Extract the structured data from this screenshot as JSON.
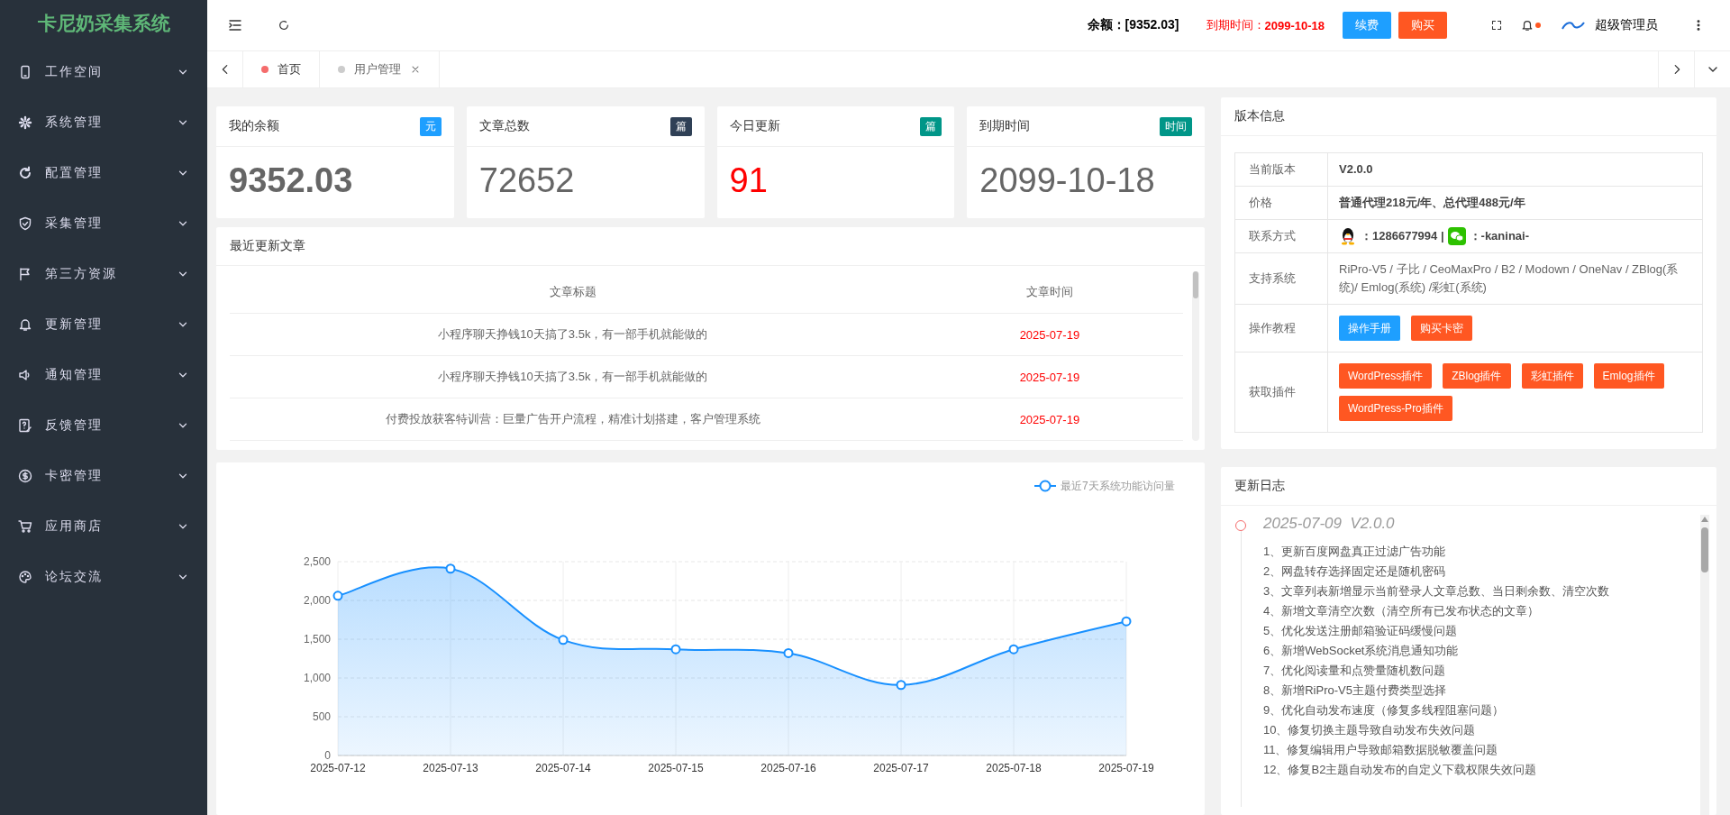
{
  "sidebar": {
    "logo": "卡尼奶采集系统",
    "items": [
      {
        "label": "工作空间"
      },
      {
        "label": "系统管理"
      },
      {
        "label": "配置管理"
      },
      {
        "label": "采集管理"
      },
      {
        "label": "第三方资源"
      },
      {
        "label": "更新管理"
      },
      {
        "label": "通知管理"
      },
      {
        "label": "反馈管理"
      },
      {
        "label": "卡密管理"
      },
      {
        "label": "应用商店"
      },
      {
        "label": "论坛交流"
      }
    ]
  },
  "header": {
    "balance": "余额：[9352.03]",
    "expire_label": "到期时间：",
    "expire_value": "2099-10-18",
    "buttons": [
      {
        "label": "续费",
        "color": "#1e9fff"
      },
      {
        "label": "购买",
        "color": "#ff5722"
      }
    ],
    "user": "超级管理员"
  },
  "tabs": [
    {
      "label": "首页",
      "selected": true,
      "closable": false
    },
    {
      "label": "用户管理",
      "selected": false,
      "closable": true
    }
  ],
  "stat_cards": [
    {
      "title": "我的余额",
      "badge": "元",
      "color": "#1e9fff",
      "value": "9352.03",
      "kind": "bold"
    },
    {
      "title": "文章总数",
      "badge": "篇",
      "color": "#2f4056",
      "value": "72652",
      "kind": "plain"
    },
    {
      "title": "今日更新",
      "badge": "篇",
      "color": "#009688",
      "value": "91",
      "kind": "alert"
    },
    {
      "title": "到期时间",
      "badge": "时间",
      "color": "#009688",
      "value": "2099-10-18",
      "kind": "plain"
    }
  ],
  "recent_articles": {
    "title": "最近更新文章",
    "columns": [
      "文章标题",
      "文章时间"
    ],
    "rows": [
      [
        "小程序聊天挣钱10天搞了3.5k，有一部手机就能做的",
        "2025-07-19"
      ],
      [
        "小程序聊天挣钱10天搞了3.5k，有一部手机就能做的",
        "2025-07-19"
      ],
      [
        "付费投放获客特训营：巨量广告开户流程，精准计划搭建，客户管理系统",
        "2025-07-19"
      ]
    ]
  },
  "visits_chart": {
    "chart_data": {
      "type": "area",
      "categories": [
        "2025-07-12",
        "2025-07-13",
        "2025-07-14",
        "2025-07-15",
        "2025-07-16",
        "2025-07-17",
        "2025-07-18",
        "2025-07-19"
      ],
      "series": [
        {
          "name": "最近7天系统功能访问量",
          "color": "#1890ff",
          "values": [
            2060,
            2410,
            1490,
            1370,
            1320,
            910,
            1370,
            1730
          ]
        }
      ],
      "ylim": [
        0,
        2500
      ],
      "grid": true,
      "yticks": [
        {
          "value": 0,
          "label": "0"
        },
        {
          "value": 500,
          "label": "500"
        },
        {
          "value": 1000,
          "label": "1,000"
        },
        {
          "value": 1500,
          "label": "1,500"
        },
        {
          "value": 2000,
          "label": "2,000"
        },
        {
          "value": 2500,
          "label": "2,500"
        }
      ]
    }
  },
  "version_info": {
    "title": "版本信息",
    "rows": [
      {
        "label": "当前版本",
        "kind": "bold",
        "value": "V2.0.0"
      },
      {
        "label": "价格",
        "kind": "bold",
        "value": "普通代理218元/年、总代理488元/年"
      },
      {
        "label": "联系方式",
        "kind": "contact",
        "qq": "：1286677994 |",
        "wechat": "：-kaninai-"
      },
      {
        "label": "支持系统",
        "kind": "text",
        "value": "RiPro-V5 / 子比 / CeoMaxPro / B2 / Modown / OneNav / ZBlog(系统)/ Emlog(系统) /彩虹(系统)"
      },
      {
        "label": "操作教程",
        "kind": "buttons",
        "buttons": [
          {
            "label": "操作手册",
            "color": "#1e9fff"
          },
          {
            "label": "购买卡密",
            "color": "#ff5722"
          }
        ]
      },
      {
        "label": "获取插件",
        "kind": "buttons",
        "buttons": [
          {
            "label": "WordPress插件",
            "color": "#ff5722"
          },
          {
            "label": "ZBlog插件",
            "color": "#ff5722"
          },
          {
            "label": "彩虹插件",
            "color": "#ff5722"
          },
          {
            "label": "Emlog插件",
            "color": "#ff5722"
          },
          {
            "label": "WordPress-Pro插件",
            "color": "#ff5722"
          }
        ]
      }
    ]
  },
  "changelog": {
    "title": "更新日志",
    "entries": [
      {
        "heading": "2025-07-09  V2.0.0",
        "items": [
          "1、更新百度网盘真正过滤广告功能",
          "2、网盘转存选择固定还是随机密码",
          "3、文章列表新增显示当前登录人文章总数、当日剩余数、清空次数",
          "4、新增文章清空次数（清空所有已发布状态的文章）",
          "5、优化发送注册邮箱验证码缓慢问题",
          "6、新增WebSocket系统消息通知功能",
          "7、优化阅读量和点赞量随机数问题",
          "8、新增RiPro-V5主题付费类型选择",
          "9、优化自动发布速度（修复多线程阻塞问题）",
          "10、修复切换主题导致自动发布失效问题",
          "11、修复编辑用户导致邮箱数据脱敏覆盖问题",
          "12、修复B2主题自动发布的自定义下载权限失效问题"
        ]
      }
    ]
  }
}
